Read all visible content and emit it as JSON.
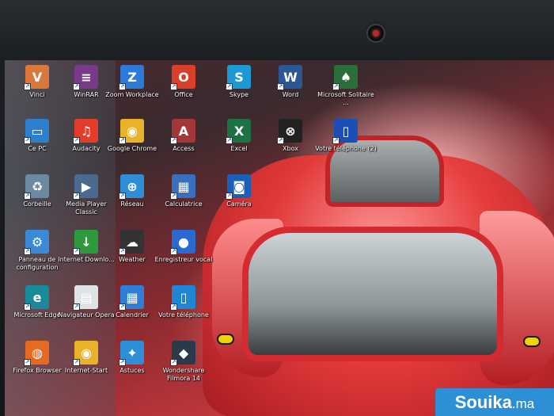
{
  "desktop": {
    "icons": [
      {
        "label": "Vinci",
        "icon": "vinci-icon",
        "color": "#d9783a"
      },
      {
        "label": "WinRAR",
        "icon": "winrar-icon",
        "color": "#7a3a8c"
      },
      {
        "label": "Zoom Workplace",
        "icon": "zoom-icon",
        "color": "#2d7bd8"
      },
      {
        "label": "Office",
        "icon": "office-icon",
        "color": "#d8402a"
      },
      {
        "label": "Skype",
        "icon": "skype-icon",
        "color": "#1c9ad6"
      },
      {
        "label": "Word",
        "icon": "word-icon",
        "color": "#2b5797"
      },
      {
        "label": "Microsoft Solitaire ...",
        "icon": "solitaire-icon",
        "color": "#2a6e3a"
      },
      {
        "label": "Ce PC",
        "icon": "computer-icon",
        "color": "#2f7fcf"
      },
      {
        "label": "Audacity",
        "icon": "audacity-icon",
        "color": "#e33c2b"
      },
      {
        "label": "Google Chrome",
        "icon": "chrome-icon",
        "color": "#e8b22a"
      },
      {
        "label": "Access",
        "icon": "access-icon",
        "color": "#a4373a"
      },
      {
        "label": "Excel",
        "icon": "excel-icon",
        "color": "#1e7145"
      },
      {
        "label": "Xbox",
        "icon": "xbox-icon",
        "color": "#222222"
      },
      {
        "label": "Votre téléphone (2)",
        "icon": "phone-icon",
        "color": "#1a4fb5"
      },
      {
        "label": "Corbeille",
        "icon": "recycle-bin-icon",
        "color": "#6b8aa0"
      },
      {
        "label": "Media Player Classic",
        "icon": "media-player-icon",
        "color": "#4a6a90"
      },
      {
        "label": "Réseau",
        "icon": "network-icon",
        "color": "#2f8fd6"
      },
      {
        "label": "Calculatrice",
        "icon": "calculator-icon",
        "color": "#3a6fc0"
      },
      {
        "label": "Caméra",
        "icon": "camera-icon",
        "color": "#1b5fb6"
      },
      {
        "label": "Panneau de configuration",
        "icon": "control-panel-icon",
        "color": "#3a8ad6"
      },
      {
        "label": "Internet Downlo...",
        "icon": "idm-icon",
        "color": "#2e9a3e"
      },
      {
        "label": "Weather",
        "icon": "weather-icon",
        "color": "#333333"
      },
      {
        "label": "Enregistreur vocal",
        "icon": "voice-recorder-icon",
        "color": "#2a6ad0"
      },
      {
        "label": "Microsoft Edge",
        "icon": "edge-icon",
        "color": "#1a8a9a"
      },
      {
        "label": "Navigateur Opera",
        "icon": "opera-file-icon",
        "color": "#dfe3e6"
      },
      {
        "label": "Calendrier",
        "icon": "calendar-icon",
        "color": "#2f7fd6"
      },
      {
        "label": "Votre téléphone",
        "icon": "phone-icon",
        "color": "#1f86d6"
      },
      {
        "label": "Firefox Browser",
        "icon": "firefox-icon",
        "color": "#e66a20"
      },
      {
        "label": "Internet-Start",
        "icon": "chrome-icon",
        "color": "#e8b22a"
      },
      {
        "label": "Astuces",
        "icon": "tips-icon",
        "color": "#2f8fd6"
      },
      {
        "label": "Wondershare Filmora 14",
        "icon": "filmora-icon",
        "color": "#2a3a4a"
      }
    ]
  },
  "watermark": {
    "name": "Souika",
    "tld": ".ma"
  }
}
